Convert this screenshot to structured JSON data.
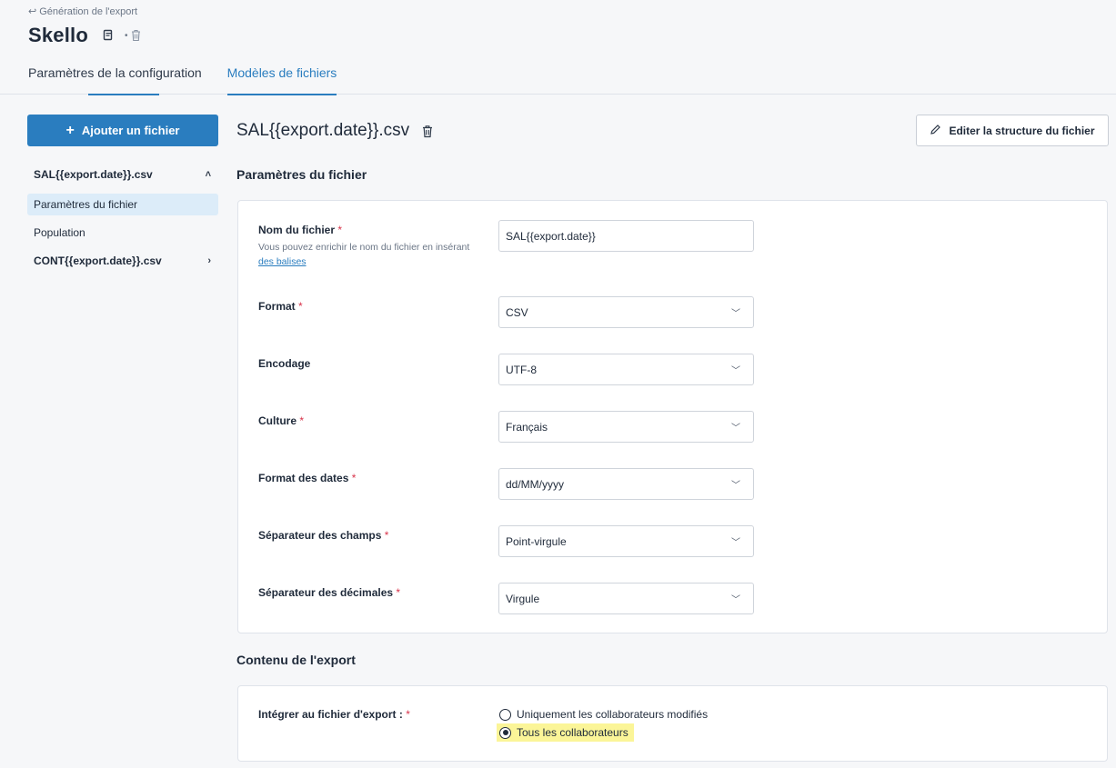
{
  "header": {
    "back_label": "Génération de l'export",
    "title": "Skello",
    "tabs": [
      {
        "label": "Paramètres de la configuration",
        "active": false
      },
      {
        "label": "Modèles de fichiers",
        "active": true
      }
    ]
  },
  "sidebar": {
    "add_button_label": "Ajouter un fichier",
    "items": [
      {
        "label": "SAL{{export.date}}.csv",
        "chevron": "˄"
      },
      {
        "label": "Paramètres du fichier"
      },
      {
        "label": "Population"
      },
      {
        "label": "CONT{{export.date}}.csv",
        "chevron": "›"
      }
    ]
  },
  "main": {
    "file_title": "SAL{{export.date}}.csv",
    "edit_button_label": "Editer la structure du fichier",
    "section_params": "Paramètres du fichier",
    "fields": {
      "filename": {
        "label": "Nom du fichier",
        "required": "*",
        "help_text": "Vous pouvez enrichir le nom du fichier en insérant",
        "help_link": "des balises",
        "value": "SAL{{export.date}}"
      },
      "format": {
        "label": "Format",
        "required": "*",
        "value": "CSV"
      },
      "encoding": {
        "label": "Encodage",
        "value": "UTF-8"
      },
      "culture": {
        "label": "Culture",
        "required": "*",
        "value": "Français"
      },
      "date_format": {
        "label": "Format des dates",
        "required": "*",
        "value": "dd/MM/yyyy"
      },
      "field_separator": {
        "label": "Séparateur des champs",
        "required": "*",
        "value": "Point-virgule"
      },
      "decimal_separator": {
        "label": "Séparateur des décimales",
        "required": "*",
        "value": "Virgule"
      }
    },
    "section_content": "Contenu de l'export",
    "export_content": {
      "label": "Intégrer au fichier d'export :",
      "required": "*",
      "options": [
        {
          "label": "Uniquement les collaborateurs modifiés",
          "selected": false
        },
        {
          "label": "Tous les collaborateurs",
          "selected": true
        }
      ]
    }
  },
  "colors": {
    "accent": "#2a7dbf",
    "required": "#d8334a",
    "selected_bg": "#dcecf9",
    "highlight": "#fbf598"
  }
}
